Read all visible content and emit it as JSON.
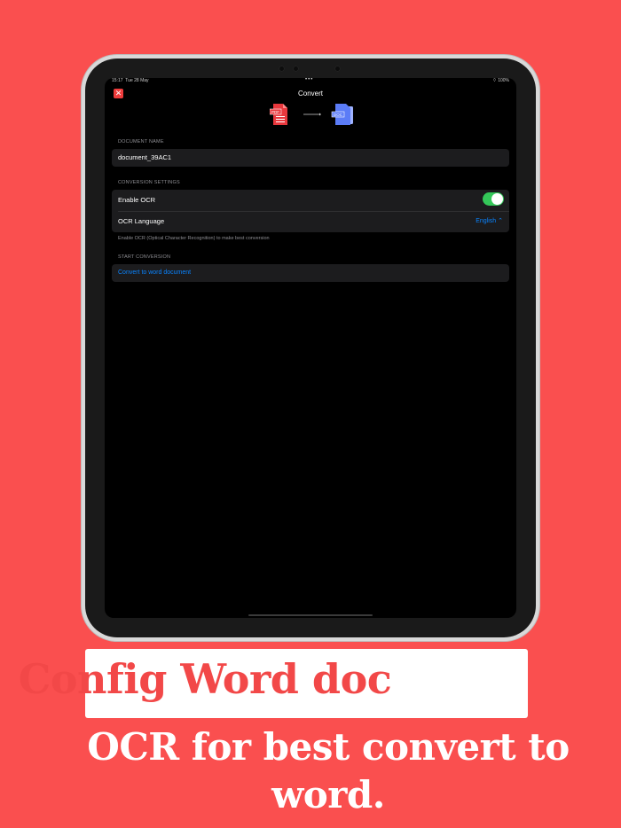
{
  "status_bar": {
    "time": "15:17",
    "date": "Tue 28 May",
    "battery": "100%"
  },
  "nav": {
    "title": "Convert",
    "close_icon": "close-x-icon"
  },
  "conversion_icons": {
    "from_badge": "PDF",
    "to_badge": "DOC"
  },
  "document_name_section": {
    "header": "DOCUMENT NAME",
    "value": "document_39AC1"
  },
  "conversion_settings": {
    "header": "CONVERSION SETTINGS",
    "enable_ocr_label": "Enable OCR",
    "enable_ocr_on": true,
    "ocr_language_label": "OCR Language",
    "ocr_language_value": "English ⌃",
    "footer": "Enable OCR (Optical Character Recognition) to make best conversion"
  },
  "start_conversion": {
    "header": "START CONVERSION",
    "button_label": "Convert to word document"
  },
  "caption": {
    "title": "Config Word doc",
    "subtitle_line1": "OCR for best convert to",
    "subtitle_line2": "word."
  },
  "colors": {
    "background": "#fa4f4f",
    "accent_blue": "#0a84ff",
    "toggle_green": "#34c759",
    "close_red": "#f03c3c"
  }
}
